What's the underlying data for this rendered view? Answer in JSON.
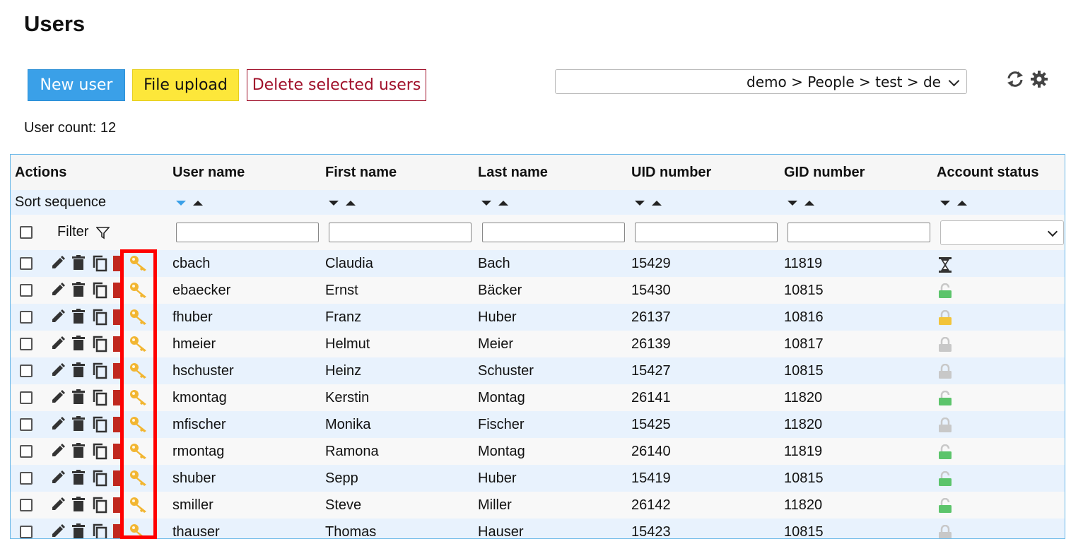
{
  "page": {
    "title": "Users"
  },
  "toolbar": {
    "new_user": "New user",
    "file_upload": "File upload",
    "delete_selected": "Delete selected users",
    "tree_path": "demo > People > test > de"
  },
  "user_count": "User count: 12",
  "table": {
    "headers": [
      "Actions",
      "User name",
      "First name",
      "Last name",
      "UID number",
      "GID number",
      "Account status"
    ],
    "sort_label": "Sort sequence",
    "filter_label": "Filter",
    "rows": [
      {
        "username": "cbach",
        "first": "Claudia",
        "last": "Bach",
        "uid": "15429",
        "gid": "11819",
        "status": "hourglass"
      },
      {
        "username": "ebaecker",
        "first": "Ernst",
        "last": "Bäcker",
        "uid": "15430",
        "gid": "10815",
        "status": "unlocked-green"
      },
      {
        "username": "fhuber",
        "first": "Franz",
        "last": "Huber",
        "uid": "26137",
        "gid": "10816",
        "status": "locked-yellow"
      },
      {
        "username": "hmeier",
        "first": "Helmut",
        "last": "Meier",
        "uid": "26139",
        "gid": "10817",
        "status": "locked-gray"
      },
      {
        "username": "hschuster",
        "first": "Heinz",
        "last": "Schuster",
        "uid": "15427",
        "gid": "10815",
        "status": "locked-gray"
      },
      {
        "username": "kmontag",
        "first": "Kerstin",
        "last": "Montag",
        "uid": "26141",
        "gid": "11820",
        "status": "unlocked-green"
      },
      {
        "username": "mfischer",
        "first": "Monika",
        "last": "Fischer",
        "uid": "15425",
        "gid": "11820",
        "status": "locked-gray"
      },
      {
        "username": "rmontag",
        "first": "Ramona",
        "last": "Montag",
        "uid": "26140",
        "gid": "11819",
        "status": "unlocked-green"
      },
      {
        "username": "shuber",
        "first": "Sepp",
        "last": "Huber",
        "uid": "15419",
        "gid": "10815",
        "status": "unlocked-green"
      },
      {
        "username": "smiller",
        "first": "Steve",
        "last": "Miller",
        "uid": "26142",
        "gid": "11820",
        "status": "unlocked-green"
      },
      {
        "username": "thauser",
        "first": "Thomas",
        "last": "Hauser",
        "uid": "15423",
        "gid": "10815",
        "status": "locked-gray"
      }
    ]
  },
  "colors": {
    "primary": "#3aa0e8",
    "warning": "#fde73a",
    "danger": "#a0102a",
    "highlight_box": "#ff0000",
    "key_icon": "#f2b632",
    "row_alt": "#e8f2fd"
  }
}
